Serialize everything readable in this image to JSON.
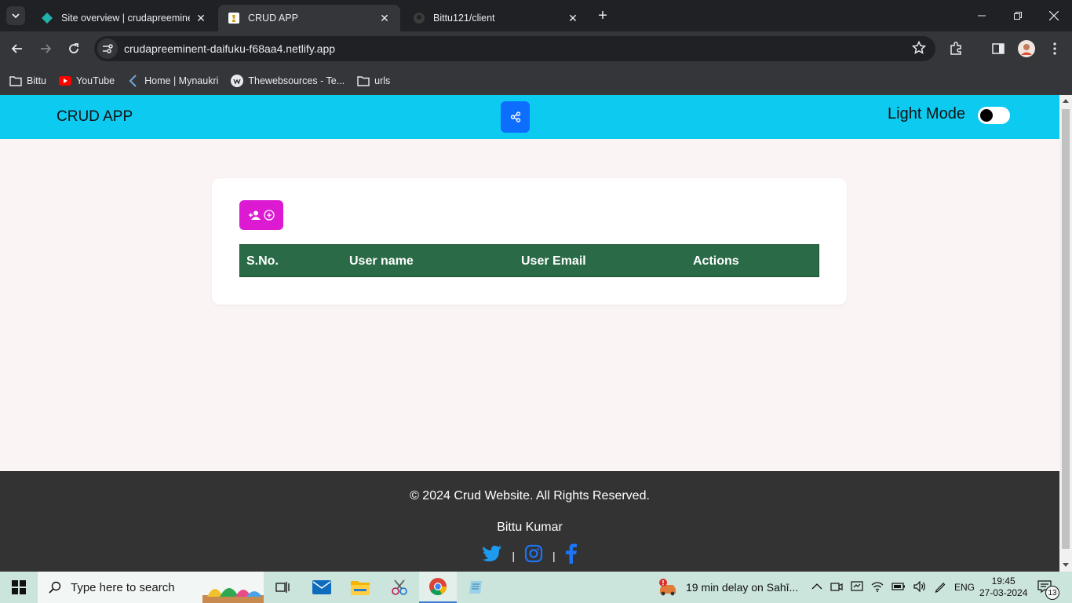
{
  "browser": {
    "tabs": [
      {
        "title": "Site overview | crudapreeminent",
        "active": false
      },
      {
        "title": "CRUD APP",
        "active": true
      },
      {
        "title": "Bittu121/client",
        "active": false
      }
    ],
    "url": "crudapreeminent-daifuku-f68aa4.netlify.app",
    "bookmarks": [
      {
        "label": "Bittu",
        "icon": "folder-icon"
      },
      {
        "label": "YouTube",
        "icon": "youtube-icon"
      },
      {
        "label": "Home | Mynaukri",
        "icon": "mynaukri-icon"
      },
      {
        "label": "Thewebsources - Te...",
        "icon": "websources-icon"
      },
      {
        "label": "urls",
        "icon": "folder-icon"
      }
    ]
  },
  "app": {
    "brand": "CRUD APP",
    "mode_label": "Light Mode",
    "table": {
      "columns": [
        "S.No.",
        "User name",
        "User Email",
        "Actions"
      ],
      "rows": []
    },
    "footer": {
      "copyright": "© 2024 Crud Website. All Rights Reserved.",
      "author": "Bittu Kumar",
      "separator": "|"
    }
  },
  "taskbar": {
    "search_placeholder": "Type here to search",
    "news": "19 min delay on Sahī...",
    "language": "ENG",
    "time": "19:45",
    "date": "27-03-2024",
    "notifications": "13"
  },
  "colors": {
    "header": "#0dcaf0",
    "share_button": "#0d6efd",
    "add_button": "#dc1ad2",
    "table_head": "#2a6a47",
    "footer": "#333333"
  }
}
